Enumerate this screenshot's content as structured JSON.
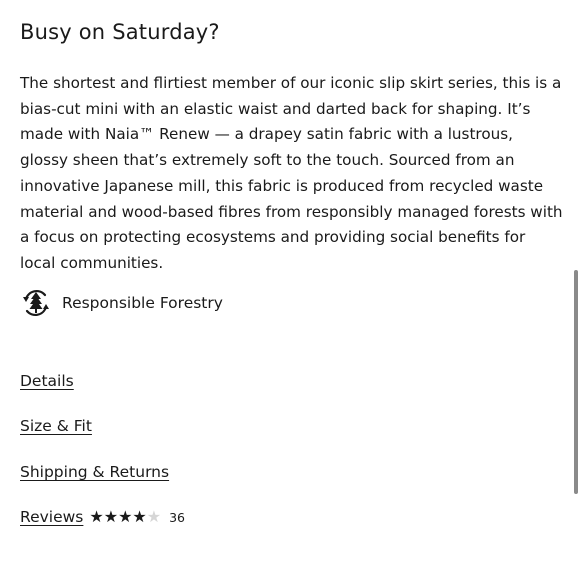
{
  "product": {
    "heading": "Busy on Saturday?",
    "description": "The shortest and flirtiest member of our iconic slip skirt series, this is a bias-cut mini with an elastic waist and darted back for shaping. It’s made with Naia™ Renew — a drapey satin fabric with a lustrous, glossy sheen that’s extremely soft to the touch. Sourced from an innovative Japanese mill, this fabric is produced from recycled waste material and wood-based fibres from responsibly managed forests with a focus on protecting ecosystems and providing social benefits for local communities.",
    "badge": {
      "icon": "forest-recycle-icon",
      "label": "Responsible Forestry"
    }
  },
  "accordion": {
    "details_label": "Details",
    "size_fit_label": "Size & Fit",
    "shipping_label": "Shipping & Returns",
    "reviews_label": "Reviews"
  },
  "reviews": {
    "rating": 4,
    "max_rating": 5,
    "count": "36"
  },
  "scrollbar": {
    "thumb_color": "#8a8a8a"
  }
}
